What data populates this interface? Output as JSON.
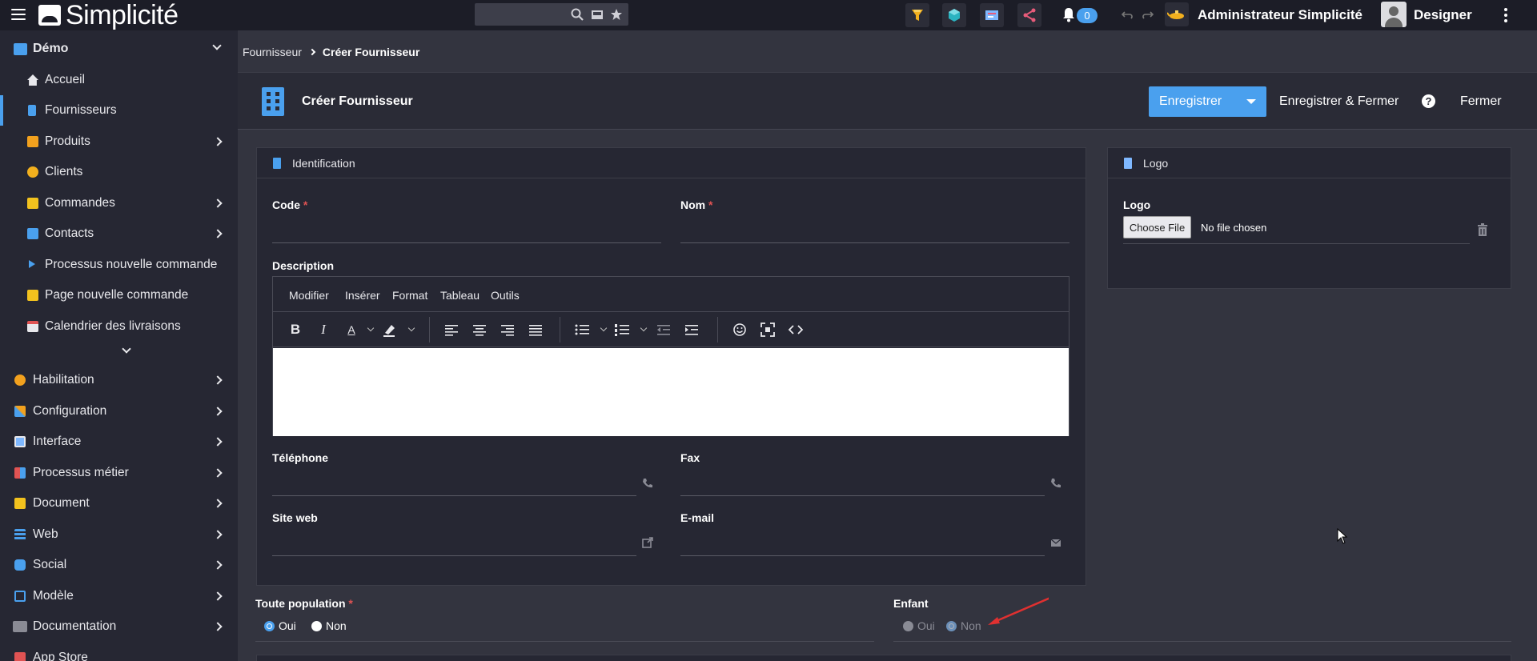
{
  "app": {
    "logo_text": "Simplicité"
  },
  "topbar": {
    "search_placeholder": "",
    "notifications_count": "0",
    "user_name": "Administrateur Simplicité",
    "role": "Designer"
  },
  "sidebar": {
    "group_title": "Démo",
    "items": [
      {
        "label": "Accueil"
      },
      {
        "label": "Fournisseurs"
      },
      {
        "label": "Produits"
      },
      {
        "label": "Clients"
      },
      {
        "label": "Commandes"
      },
      {
        "label": "Contacts"
      },
      {
        "label": "Processus nouvelle commande"
      },
      {
        "label": "Page nouvelle commande"
      },
      {
        "label": "Calendrier des livraisons"
      }
    ],
    "sections": [
      {
        "label": "Habilitation"
      },
      {
        "label": "Configuration"
      },
      {
        "label": "Interface"
      },
      {
        "label": "Processus métier"
      },
      {
        "label": "Document"
      },
      {
        "label": "Web"
      },
      {
        "label": "Social"
      },
      {
        "label": "Modèle"
      },
      {
        "label": "Documentation"
      },
      {
        "label": "App Store"
      }
    ]
  },
  "breadcrumb": {
    "parent": "Fournisseur",
    "current": "Créer Fournisseur"
  },
  "header": {
    "title": "Créer Fournisseur",
    "save": "Enregistrer",
    "save_close": "Enregistrer & Fermer",
    "help": "?",
    "close": "Fermer"
  },
  "identification": {
    "title": "Identification",
    "code_label": "Code",
    "nom_label": "Nom",
    "required_mark": "*",
    "description_label": "Description",
    "editor_menu": [
      "Modifier",
      "Insérer",
      "Format",
      "Tableau",
      "Outils"
    ],
    "telephone_label": "Téléphone",
    "fax_label": "Fax",
    "site_label": "Site web",
    "email_label": "E-mail"
  },
  "logo_panel": {
    "title": "Logo",
    "field_label": "Logo",
    "choose_label": "Choose File",
    "no_file": "No file chosen"
  },
  "toute_population": {
    "label": "Toute population",
    "required_mark": "*",
    "oui": "Oui",
    "non": "Non",
    "selected": "Oui"
  },
  "enfant": {
    "label": "Enfant",
    "oui": "Oui",
    "non": "Non",
    "selected": "Non"
  },
  "colors": {
    "accent": "#4aa0ee",
    "background": "#33343f",
    "sidebar": "#262733",
    "required": "#e05353"
  }
}
